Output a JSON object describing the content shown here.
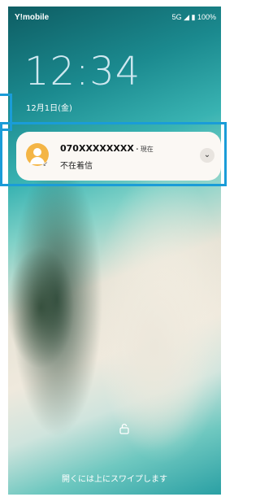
{
  "status_bar": {
    "carrier": "Y!mobile",
    "indicators": "5G ◢ ▮ 100%"
  },
  "lockscreen": {
    "time": "12:34",
    "date": "12月1日(金)",
    "unlock_hint": "開くには上にスワイプします"
  },
  "notification": {
    "caller": "070XXXXXXXX",
    "time_sep": "・現在",
    "body": "不在着信",
    "expand_glyph": "⌄"
  },
  "icons": {
    "avatar": "person-avatar-icon",
    "missed": "missed-call-icon",
    "lock": "unlock-icon"
  },
  "colors": {
    "highlight": "#1a9cd8",
    "avatar": "#f4b545"
  }
}
